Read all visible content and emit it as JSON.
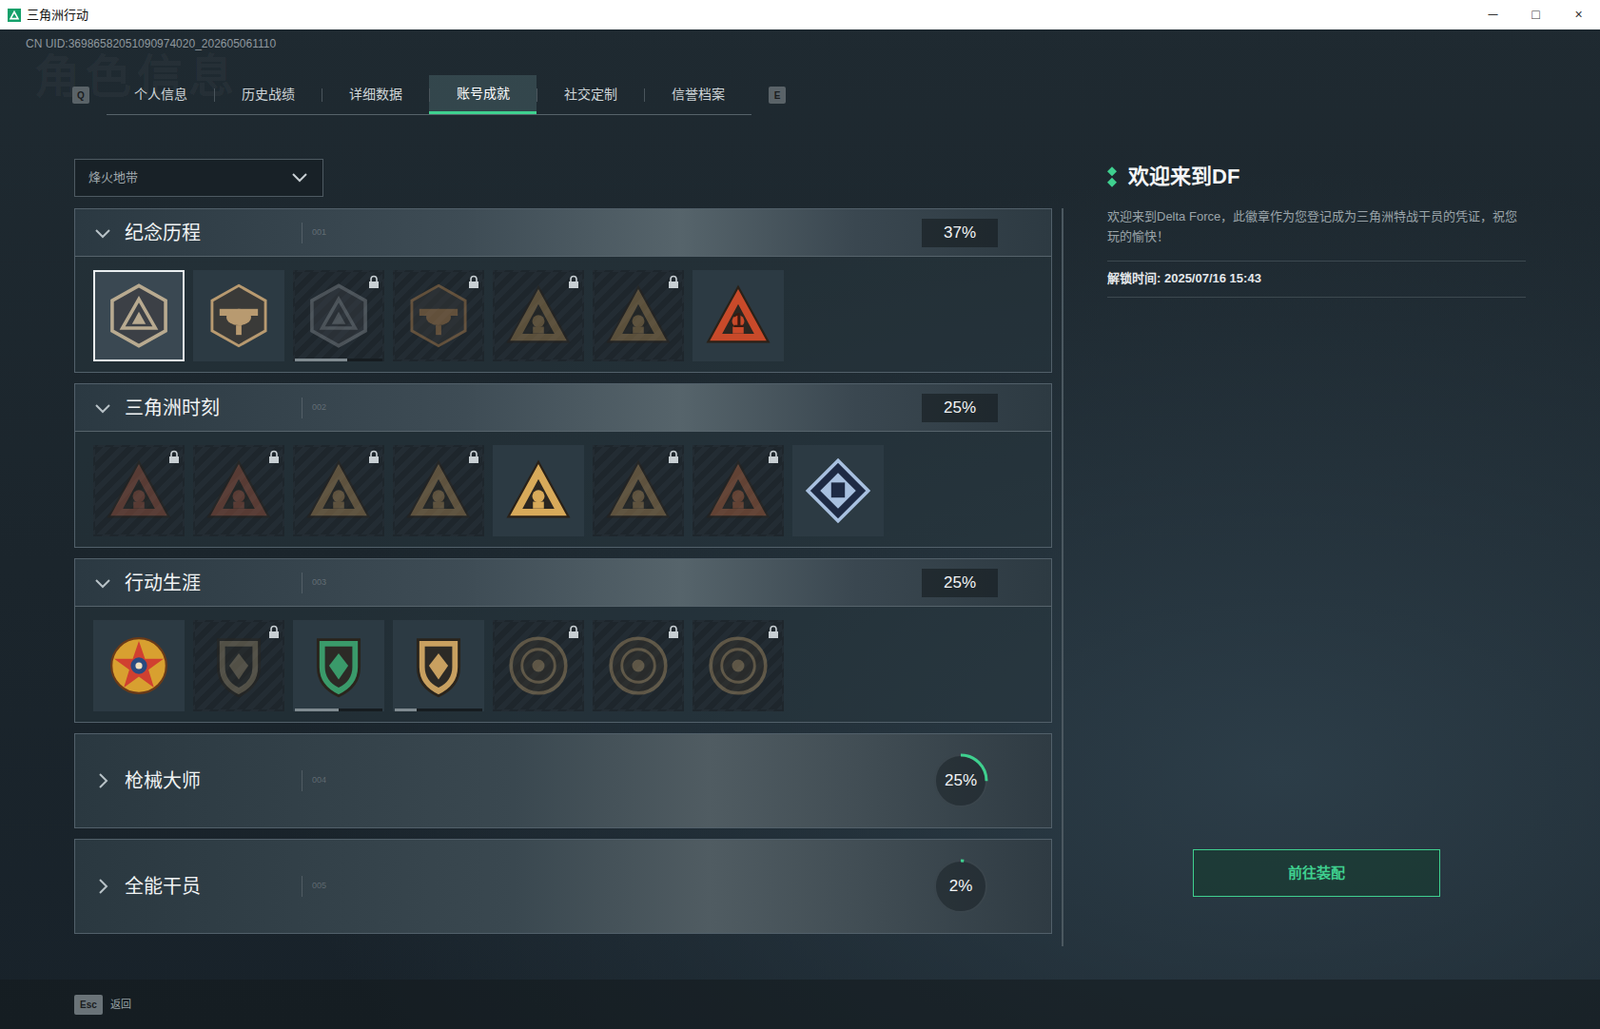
{
  "window": {
    "title": "三角洲行动",
    "controls": [
      "─",
      "□",
      "×"
    ]
  },
  "uid": "CN UID:36986582051090974020_202605061110",
  "watermark": "角色信息",
  "tabs": {
    "prev_key": "Q",
    "next_key": "E",
    "items": [
      {
        "label": "个人信息",
        "selected": false
      },
      {
        "label": "历史战绩",
        "selected": false
      },
      {
        "label": "详细数据",
        "selected": false
      },
      {
        "label": "账号成就",
        "selected": true
      },
      {
        "label": "社交定制",
        "selected": false
      },
      {
        "label": "信誉档案",
        "selected": false
      }
    ]
  },
  "mode_select": {
    "value": "烽火地带"
  },
  "sections": [
    {
      "title": "纪念历程",
      "number": "001",
      "percent": "37%",
      "expanded": true,
      "badges": [
        {
          "kind": "hex",
          "locked": false,
          "selected": true,
          "color": "#b8aa90"
        },
        {
          "kind": "crest",
          "locked": false,
          "selected": false,
          "color": "#b89a70"
        },
        {
          "kind": "hex",
          "locked": true,
          "selected": false,
          "color": "#8a9096",
          "level": 0.6
        },
        {
          "kind": "crest",
          "locked": true,
          "selected": false,
          "color": "#c08a50"
        },
        {
          "kind": "triangle",
          "locked": true,
          "selected": false,
          "color": "#b08a50"
        },
        {
          "kind": "triangle",
          "locked": true,
          "selected": false,
          "color": "#b08a50"
        },
        {
          "kind": "triangle",
          "locked": false,
          "selected": false,
          "color": "#c84a2a",
          "label": "1"
        }
      ]
    },
    {
      "title": "三角洲时刻",
      "number": "002",
      "percent": "25%",
      "expanded": true,
      "badges": [
        {
          "kind": "triangle",
          "locked": true,
          "selected": false,
          "color": "#a85a40"
        },
        {
          "kind": "triangle",
          "locked": true,
          "selected": false,
          "color": "#a85a40"
        },
        {
          "kind": "triangle",
          "locked": true,
          "selected": false,
          "color": "#b89058"
        },
        {
          "kind": "triangle",
          "locked": true,
          "selected": false,
          "color": "#b89058"
        },
        {
          "kind": "triangle",
          "locked": false,
          "selected": false,
          "color": "#d8aa5a"
        },
        {
          "kind": "triangle",
          "locked": true,
          "selected": false,
          "color": "#b89058"
        },
        {
          "kind": "triangle",
          "locked": true,
          "selected": false,
          "color": "#c06a40"
        },
        {
          "kind": "diamond",
          "locked": false,
          "selected": false,
          "color": "#a8c0e0"
        }
      ]
    },
    {
      "title": "行动生涯",
      "number": "003",
      "percent": "25%",
      "expanded": true,
      "badges": [
        {
          "kind": "star",
          "locked": false,
          "selected": false,
          "color": "#d8a030"
        },
        {
          "kind": "shield",
          "locked": true,
          "selected": false,
          "color": "#9a8a6a"
        },
        {
          "kind": "shield",
          "locked": false,
          "selected": false,
          "color": "#3a9a6a",
          "level": 0.5
        },
        {
          "kind": "shield",
          "locked": false,
          "selected": false,
          "color": "#c8a060",
          "level": 0.25
        },
        {
          "kind": "round",
          "locked": true,
          "selected": false,
          "color": "#b89a6a"
        },
        {
          "kind": "round",
          "locked": true,
          "selected": false,
          "color": "#b89a6a"
        },
        {
          "kind": "round",
          "locked": true,
          "selected": false,
          "color": "#b89a6a"
        }
      ]
    },
    {
      "title": "枪械大师",
      "number": "004",
      "percent": "25%",
      "expanded": false,
      "level": 0.25,
      "badges": []
    },
    {
      "title": "全能干员",
      "number": "005",
      "percent": "2%",
      "expanded": false,
      "level": 0.02,
      "badges": []
    }
  ],
  "detail": {
    "title": "欢迎来到DF",
    "description": "欢迎来到Delta Force，此徽章作为您登记成为三角洲特战干员的凭证，祝您玩的愉快！",
    "unlock_time": "解锁时间: 2025/07/16 15:43",
    "button": "前往装配"
  },
  "footer": {
    "key": "Esc",
    "label": "返回"
  }
}
